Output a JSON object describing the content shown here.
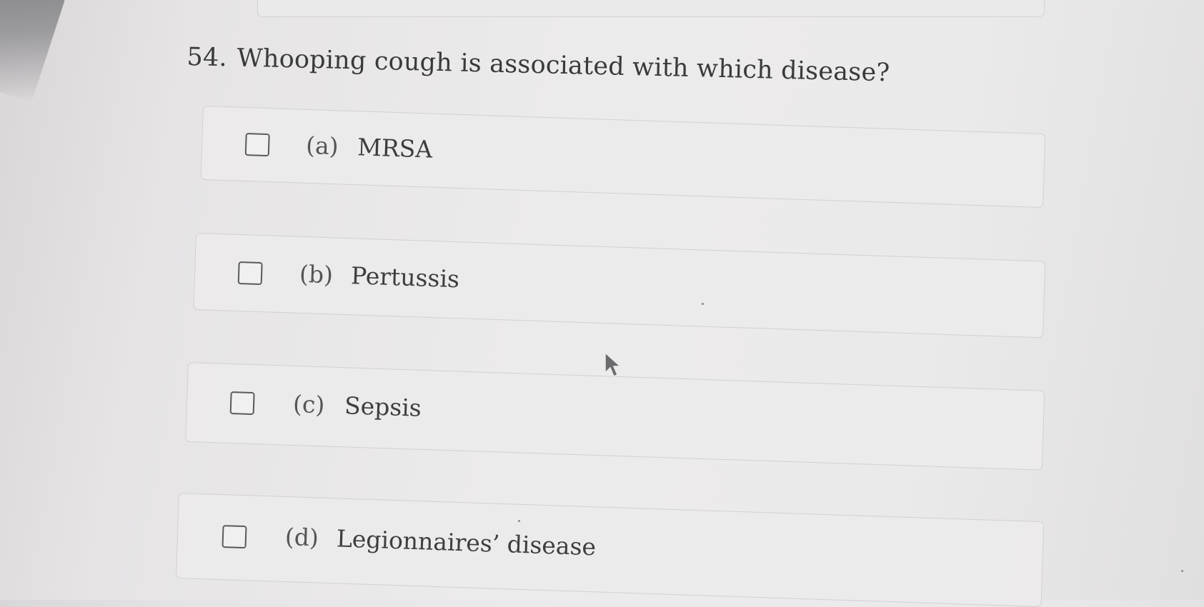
{
  "question": {
    "number": "54.",
    "text": "Whooping cough is associated with which disease?"
  },
  "options": [
    {
      "letter": "(a)",
      "label": "MRSA",
      "checked": false
    },
    {
      "letter": "(b)",
      "label": "Pertussis",
      "checked": false
    },
    {
      "letter": "(c)",
      "label": "Sepsis",
      "checked": false
    },
    {
      "letter": "(d)",
      "label": "Legionnaires’ disease",
      "checked": false
    }
  ],
  "icons": {
    "cursor": "mouse-pointer-icon",
    "checkbox": "checkbox-empty-icon"
  }
}
